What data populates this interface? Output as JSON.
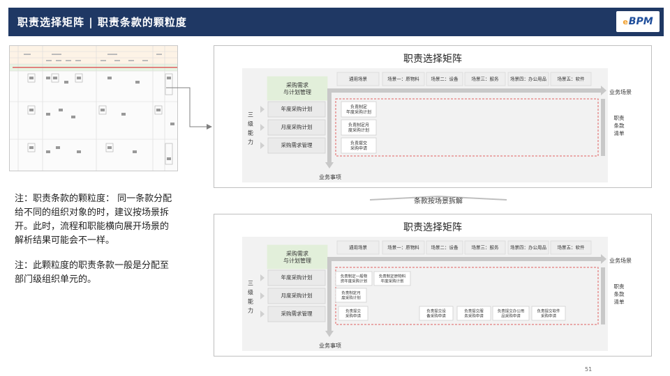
{
  "header": {
    "title": "职责选择矩阵 | 职责条款的颗粒度",
    "logo_text": "BPM",
    "logo_mark": "e"
  },
  "notes": [
    "注：职责条款的颗粒度： 同一条款分配给不同的组织对象的时，建议按场景拆开。此时，流程和职能横向展开场景的解析结果可能会不一样。",
    "注：此颗粒度的职责条款一般是分配至部门级组织单元的。"
  ],
  "split_label": "条款按场景拆解",
  "page_number": "51",
  "diagram_top": {
    "title": "职责选择矩阵",
    "header_box": "采购需求\n与计划管理",
    "left_label": "三\n级\n能\n力",
    "right_label": "职责\n条款\n清单",
    "scenario_axis_label": "业务场景",
    "event_axis_label": "业务事项",
    "scenarios": [
      "通用场景",
      "场景一：原物料",
      "场景二：设备",
      "场景三：服务",
      "场景四：办公用品",
      "场景五：软件"
    ],
    "rows": [
      "年度采购计划",
      "月度采购计划",
      "采购需求管理"
    ],
    "cells": [
      "负责制定\n年度采购计划",
      "负责制定月\n度采购计划",
      "负责提交\n采购申请"
    ]
  },
  "diagram_bottom": {
    "title": "职责选择矩阵",
    "header_box": "采购需求\n与计划管理",
    "left_label": "三\n级\n能\n力",
    "right_label": "职责\n条款\n清单",
    "scenario_axis_label": "业务场景",
    "event_axis_label": "业务事项",
    "scenarios": [
      "通用场景",
      "场景一：原物料",
      "场景二：设备",
      "场景三：服务",
      "场景四：办公用品",
      "场景五：软件"
    ],
    "rows": [
      "年度采购计划",
      "月度采购计划",
      "采购需求管理"
    ],
    "cells_row1": [
      "负责制定一般物\n资年度采购计划",
      "负责制定原物料\n年度采购计划"
    ],
    "cells_row2": [
      "负责制定月\n度采购计划"
    ],
    "cells_row3": [
      "负责提交\n采购申请",
      "负责提交设\n备采购申请",
      "负责提交服\n务采购申请",
      "负责提交办公用\n品采购申请",
      "负责提交软件\n采购申请"
    ]
  }
}
